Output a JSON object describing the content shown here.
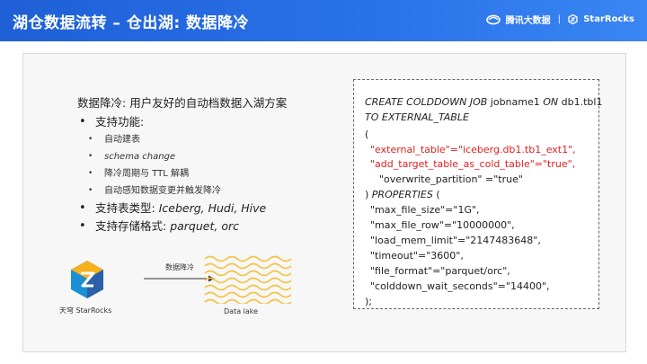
{
  "header": {
    "title": "湖仓数据流转 – 仓出湖: 数据降冷",
    "logo_tencent": "腾讯大数据",
    "logo_separator": "|",
    "logo_starrocks": "StarRocks"
  },
  "content": {
    "intro_label": "数据降冷:",
    "intro_text": "用户友好的自动档数据入湖方案",
    "bullets": [
      {
        "label": "支持功能:",
        "sub": [
          "自动建表",
          "schema change",
          "降冷周期与 TTL 解耦",
          "自动感知数据变更并触发降冷"
        ]
      },
      {
        "label": "支持表类型:",
        "value": "Iceberg, Hudi, Hive"
      },
      {
        "label": "支持存储格式:",
        "value": "parquet, orc"
      }
    ]
  },
  "diagram": {
    "source_label": "天穹 StarRocks",
    "arrow_label": "数据降冷",
    "target_label": "Data lake",
    "lake_color": "#f5c242",
    "logo_colors": [
      "#1a8fd6",
      "#f5b21e",
      "#2d5fa8"
    ]
  },
  "code": {
    "l1_kw1": "CREATE COLDDOWN JOB",
    "l1_name": " jobname1 ",
    "l1_kw2": "ON",
    "l1_table": " db1.tbl1",
    "l2": "TO EXTERNAL_TABLE",
    "l3": "(",
    "l4": "\"external_table\"=\"iceberg.db1.tb1_ext1\",",
    "l5": "\"add_target_table_as_cold_table\"=\"true\",",
    "l6": "\"overwrite_partition\" =\"true\"",
    "l7_paren": ") ",
    "l7_kw": "PROPERTIES",
    "l7_rest": " (",
    "l8": "\"max_file_size\"=\"1G\",",
    "l9": "\"max_file_row\"=\"10000000\",",
    "l10": "\"load_mem_limit\"=\"2147483648\",",
    "l11": "\"timeout\"=\"3600\",",
    "l12": "\"file_format\"=\"parquet/orc\",",
    "l13": "\"colddown_wait_seconds\"=\"14400\",",
    "l14": ");"
  }
}
